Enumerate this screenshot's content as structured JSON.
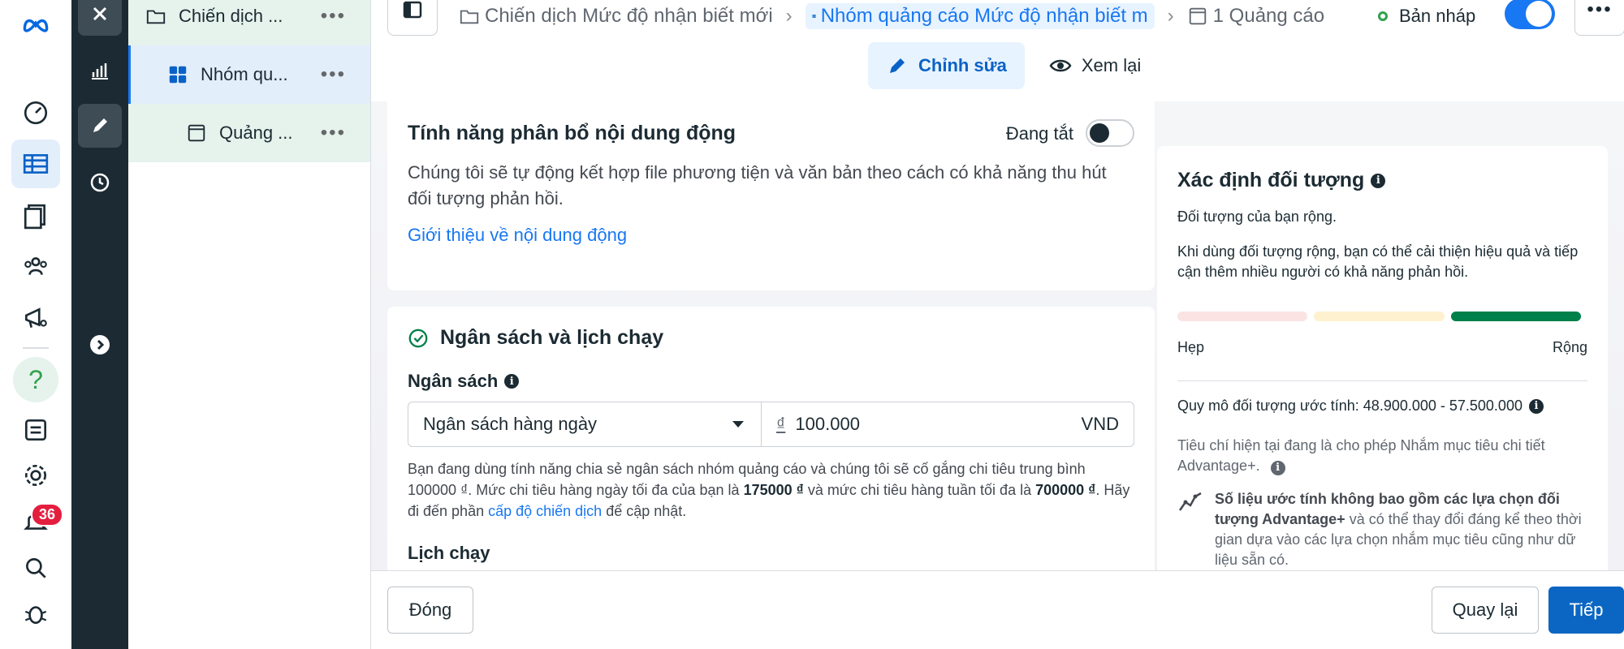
{
  "rail": {
    "notification_count": "36"
  },
  "tree": {
    "campaign_label": "Chiến dịch ...",
    "adset_label": "Nhóm qu...",
    "ad_label": "Quảng ...",
    "more": "•••"
  },
  "topbar": {
    "breadcrumbs": {
      "campaign": "Chiến dịch Mức độ nhận biết mới",
      "adset": "Nhóm quảng cáo Mức độ nhận biết m",
      "ad": "1 Quảng cáo"
    },
    "status": "Bản nháp",
    "more": "•••",
    "tabs": {
      "edit": "Chỉnh sửa",
      "review": "Xem lại"
    }
  },
  "dynamic_creative": {
    "title": "Tính năng phân bổ nội dung động",
    "toggle_label": "Đang tắt",
    "description": "Chúng tôi sẽ tự động kết hợp file phương tiện và văn bản theo cách có khả năng thu hút đối tượng phản hồi.",
    "link": "Giới thiệu về nội dung động"
  },
  "budget_schedule": {
    "title": "Ngân sách và lịch chạy",
    "budget_label": "Ngân sách",
    "budget_type": "Ngân sách hàng ngày",
    "currency_symbol": "₫",
    "amount": "100.000",
    "currency": "VND",
    "hint_part1": "Bạn đang dùng tính năng chia sẻ ngân sách nhóm quảng cáo và chúng tôi sẽ cố gắng chi tiêu trung bình 100000 ₫. Mức chi tiêu hàng ngày tối đa của bạn là ",
    "hint_max_daily": "175000 ₫",
    "hint_part2": " và mức chi tiêu hàng tuần tối đa là ",
    "hint_max_weekly": "700000 ₫",
    "hint_part3": ". Hãy đi đến phần ",
    "hint_link": "cấp độ chiến dịch",
    "hint_part4": " để cập nhật.",
    "schedule_label": "Lịch chạy"
  },
  "audience": {
    "title": "Xác định đối tượng",
    "summary": "Đối tượng của bạn rộng.",
    "tip": "Khi dùng đối tượng rộng, bạn có thể cải thiện hiệu quả và tiếp cận thêm nhiều người có khả năng phản hồi.",
    "narrow_label": "Hẹp",
    "broad_label": "Rộng",
    "meter_level": "broad",
    "meter_colors": [
      "#fbe3e4",
      "#fdf1cf",
      "#00804a"
    ],
    "size_estimate": "Quy mô đối tượng ước tính: 48.900.000 - 57.500.000",
    "criteria": "Tiêu chí hiện tại đang là cho phép Nhắm mục tiêu chi tiết Advantage+.",
    "note_part1": "Số liệu ước tính không bao gồm các lựa chọn đối tượng Advantage+",
    "note_part2": " và có thể thay đổi đáng kể theo thời gian dựa vào các lựa chọn nhắm mục tiêu cũng như dữ liệu sẵn có."
  },
  "footer": {
    "close": "Đóng",
    "back": "Quay lại",
    "next": "Tiếp"
  },
  "colors": {
    "accent": "#1877f2",
    "primary_button": "#0a66c2",
    "dark_sidebar": "#1c2b33",
    "success": "#00804a",
    "notification": "#e41e3f"
  }
}
